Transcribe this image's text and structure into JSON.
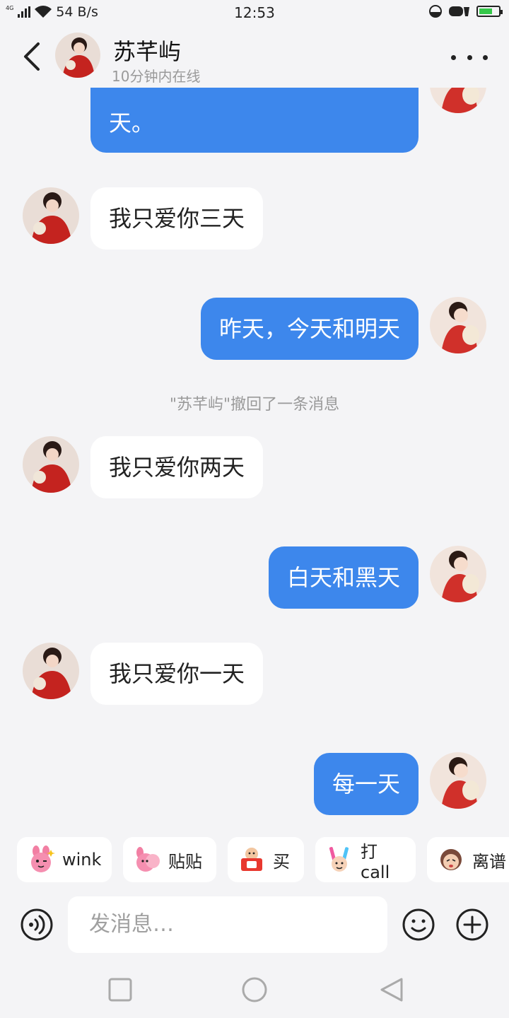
{
  "status_bar": {
    "network_type": "4G",
    "speed": "54 B/s",
    "time": "12:53",
    "battery_color": "#35c84a"
  },
  "header": {
    "name": "苏芊屿",
    "presence": "10分钟内在线"
  },
  "messages": [
    {
      "side": "out",
      "text": "春天，夏天，秋天和冬天。",
      "visible_text": "天。"
    },
    {
      "side": "in",
      "text": "我只爱你三天"
    },
    {
      "side": "out",
      "text": "昨天，今天和明天"
    },
    {
      "side": "system",
      "text": "\"苏芊屿\"撤回了一条消息"
    },
    {
      "side": "in",
      "text": "我只爱你两天"
    },
    {
      "side": "out",
      "text": "白天和黑天"
    },
    {
      "side": "in",
      "text": "我只爱你一天"
    },
    {
      "side": "out",
      "text": "每一天"
    }
  ],
  "quick_reactions": [
    {
      "label": "wink",
      "icon": "bunny-wink-sticker-icon"
    },
    {
      "label": "贴贴",
      "icon": "bunny-cuddle-sticker-icon"
    },
    {
      "label": "买",
      "icon": "buy-sign-sticker-icon"
    },
    {
      "label": "打call",
      "icon": "glowstick-sticker-icon"
    },
    {
      "label": "离谱",
      "icon": "outrageous-sticker-icon"
    }
  ],
  "input": {
    "placeholder": "发消息…"
  },
  "colors": {
    "outgoing_bubble": "#3d87ec",
    "incoming_bubble": "#ffffff",
    "background": "#f4f4f6"
  }
}
